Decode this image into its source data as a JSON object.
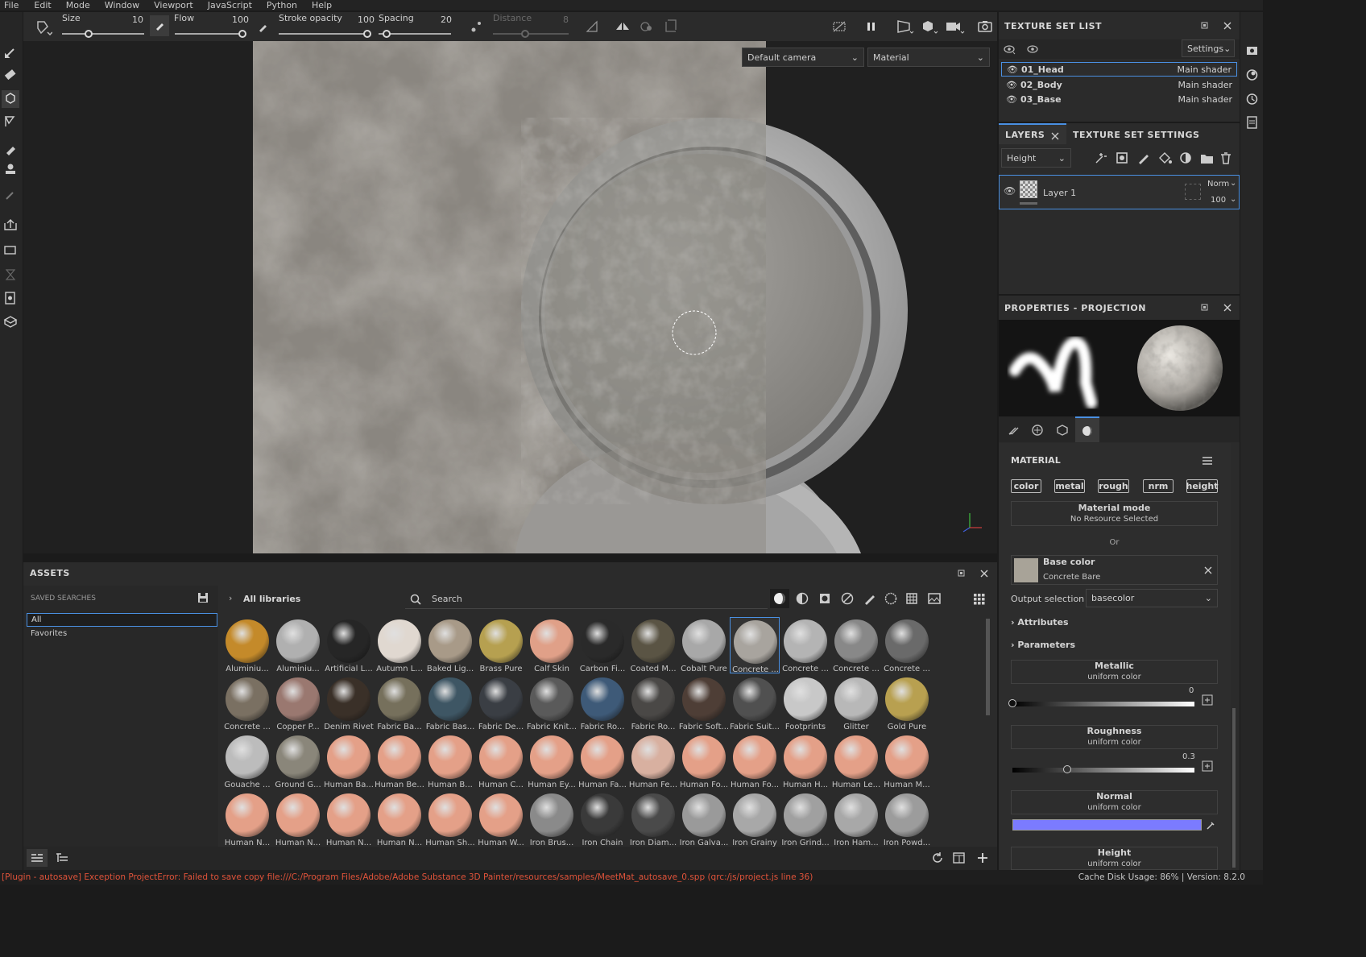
{
  "menu": [
    "File",
    "Edit",
    "Mode",
    "Window",
    "Viewport",
    "JavaScript",
    "Python",
    "Help"
  ],
  "toolbar": {
    "size_label": "Size",
    "size_value": "10",
    "flow_label": "Flow",
    "flow_value": "100",
    "stroke_opacity_label": "Stroke opacity",
    "stroke_opacity_value": "100",
    "spacing_label": "Spacing",
    "spacing_value": "20",
    "distance_label": "Distance",
    "distance_value": "8"
  },
  "viewport": {
    "camera_select": "Default camera",
    "mode_select": "Material"
  },
  "texture_set_list": {
    "title": "TEXTURE SET LIST",
    "settings_label": "Settings",
    "items": [
      {
        "name": "01_Head",
        "shader": "Main shader"
      },
      {
        "name": "02_Body",
        "shader": "Main shader"
      },
      {
        "name": "03_Base",
        "shader": "Main shader"
      }
    ]
  },
  "layers": {
    "tab_layers": "LAYERS",
    "tab_settings": "TEXTURE SET SETTINGS",
    "channel_select": "Height",
    "layer_name": "Layer 1",
    "blend_mode": "Norm",
    "opacity": "100"
  },
  "properties": {
    "title": "PROPERTIES - PROJECTION",
    "material_label": "MATERIAL",
    "chips": [
      "color",
      "metal",
      "rough",
      "nrm",
      "height"
    ],
    "material_mode_label": "Material mode",
    "material_mode_value": "No Resource Selected",
    "or_label": "Or",
    "base_color_label": "Base color",
    "base_color_value": "Concrete Bare",
    "output_selection_label": "Output selection",
    "output_selection_value": "basecolor",
    "attributes_label": "Attributes",
    "parameters_label": "Parameters",
    "metallic_label": "Metallic",
    "metallic_sub": "uniform color",
    "metallic_value": "0",
    "metallic_level": 0,
    "roughness_label": "Roughness",
    "roughness_sub": "uniform color",
    "roughness_value": "0.3",
    "roughness_level": 0.3,
    "normal_label": "Normal",
    "normal_sub": "uniform color",
    "normal_color": "#7b7bff",
    "height_label": "Height",
    "height_sub": "uniform color"
  },
  "assets": {
    "title": "ASSETS",
    "saved_searches": "SAVED SEARCHES",
    "search_items": [
      "All",
      "Favorites"
    ],
    "breadcrumb": "All libraries",
    "search_placeholder": "Search",
    "rows": [
      [
        {
          "label": "Aluminiu...",
          "color": "#c48a2a"
        },
        {
          "label": "Aluminiu...",
          "color": "#b0b0b0"
        },
        {
          "label": "Artificial L...",
          "color": "#262626"
        },
        {
          "label": "Autumn L...",
          "color": "#e0d8d0"
        },
        {
          "label": "Baked Lig...",
          "color": "#a89a88"
        },
        {
          "label": "Brass Pure",
          "color": "#b6a050"
        },
        {
          "label": "Calf Skin",
          "color": "#e0a088"
        },
        {
          "label": "Carbon Fi...",
          "color": "#2a2a2a"
        },
        {
          "label": "Coated M...",
          "color": "#5a5444"
        },
        {
          "label": "Cobalt Pure",
          "color": "#a8a8a8"
        },
        {
          "label": "Concrete ...",
          "color": "#a8a49e"
        },
        {
          "label": "Concrete ...",
          "color": "#b4b4b4"
        },
        {
          "label": "Concrete ...",
          "color": "#888888"
        },
        {
          "label": "Concrete ...",
          "color": "#6a6a6a"
        }
      ],
      [
        {
          "label": "Concrete ...",
          "color": "#7a7062"
        },
        {
          "label": "Copper P...",
          "color": "#9a7870"
        },
        {
          "label": "Denim Rivet",
          "color": "#3a3028"
        },
        {
          "label": "Fabric Ba...",
          "color": "#76705c"
        },
        {
          "label": "Fabric Bas...",
          "color": "#3e5664"
        },
        {
          "label": "Fabric De...",
          "color": "#3a3e44"
        },
        {
          "label": "Fabric Knit...",
          "color": "#5a5a5a"
        },
        {
          "label": "Fabric Ro...",
          "color": "#3e5a78"
        },
        {
          "label": "Fabric Ro...",
          "color": "#4a4846"
        },
        {
          "label": "Fabric Soft...",
          "color": "#4e3e36"
        },
        {
          "label": "Fabric Suit...",
          "color": "#505050"
        },
        {
          "label": "Footprints",
          "color": "#c8c8c8"
        },
        {
          "label": "Glitter",
          "color": "#b8b8b8"
        },
        {
          "label": "Gold Pure",
          "color": "#b8a050"
        }
      ],
      [
        {
          "label": "Gouache ...",
          "color": "#bcbcbc"
        },
        {
          "label": "Ground G...",
          "color": "#8a867a"
        },
        {
          "label": "Human Ba...",
          "color": "#e4a088"
        },
        {
          "label": "Human Be...",
          "color": "#e4a088"
        },
        {
          "label": "Human B...",
          "color": "#e4a088"
        },
        {
          "label": "Human C...",
          "color": "#e4a088"
        },
        {
          "label": "Human Ey...",
          "color": "#e4a088"
        },
        {
          "label": "Human Fa...",
          "color": "#e4a088"
        },
        {
          "label": "Human Fe...",
          "color": "#d8b0a0"
        },
        {
          "label": "Human Fo...",
          "color": "#e4a088"
        },
        {
          "label": "Human Fo...",
          "color": "#e4a088"
        },
        {
          "label": "Human H...",
          "color": "#e4a088"
        },
        {
          "label": "Human Le...",
          "color": "#e4a088"
        },
        {
          "label": "Human M...",
          "color": "#e4a088"
        }
      ],
      [
        {
          "label": "Human N...",
          "color": "#e4a088"
        },
        {
          "label": "Human N...",
          "color": "#e4a088"
        },
        {
          "label": "Human N...",
          "color": "#e4a088"
        },
        {
          "label": "Human N...",
          "color": "#e4a088"
        },
        {
          "label": "Human Sh...",
          "color": "#e4a088"
        },
        {
          "label": "Human W...",
          "color": "#e4a088"
        },
        {
          "label": "Iron Brus...",
          "color": "#8a8a8a"
        },
        {
          "label": "Iron Chain",
          "color": "#3a3a3a"
        },
        {
          "label": "Iron Diam...",
          "color": "#4a4a4a"
        },
        {
          "label": "Iron Galva...",
          "color": "#9a9a9a"
        },
        {
          "label": "Iron Grainy",
          "color": "#a8a8a8"
        },
        {
          "label": "Iron Grind...",
          "color": "#a0a0a0"
        },
        {
          "label": "Iron Ham...",
          "color": "#a8a8a8"
        },
        {
          "label": "Iron Powd...",
          "color": "#9c9c9c"
        }
      ]
    ]
  },
  "status": {
    "error": "[Plugin - autosave] Exception ProjectError: Failed to save copy file:///C:/Program Files/Adobe/Adobe Substance 3D Painter/resources/samples/MeetMat_autosave_0.spp (qrc:/js/project.js line 36)",
    "right": "Cache Disk Usage:   86% | Version: 8.2.0"
  }
}
